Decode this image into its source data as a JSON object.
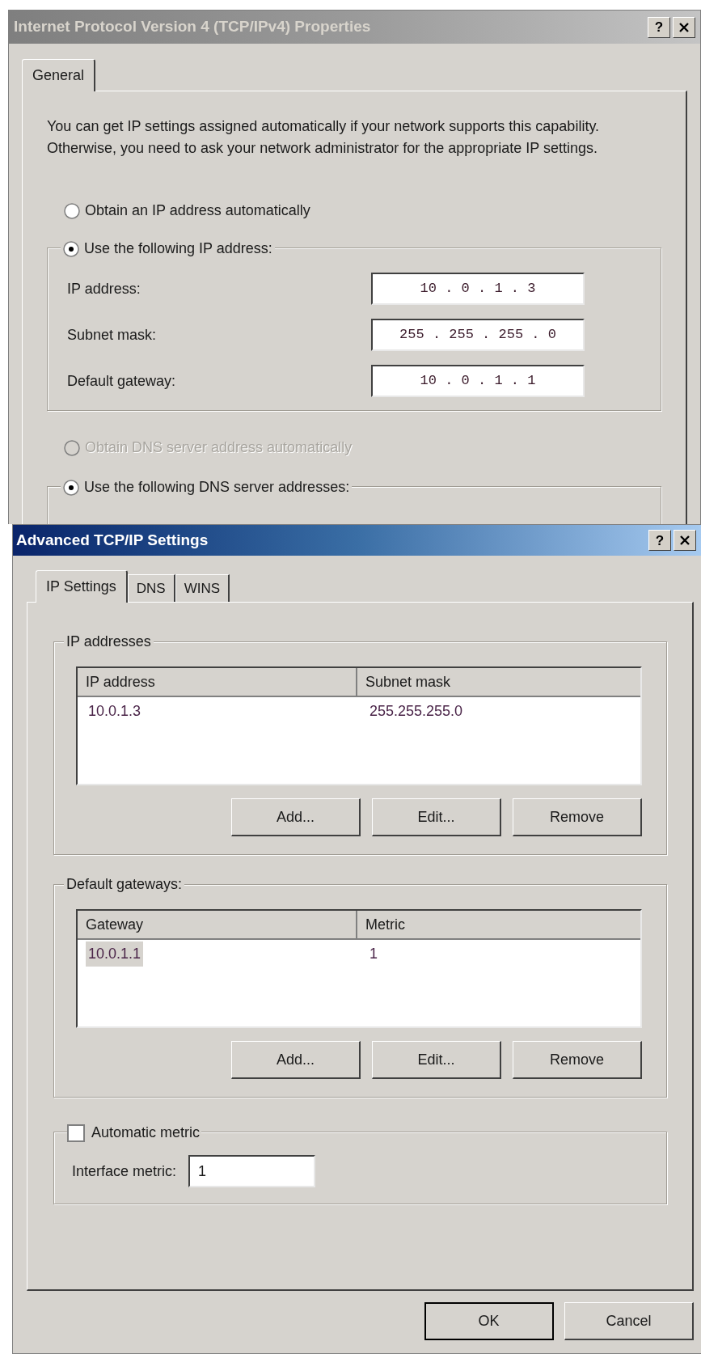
{
  "back_dialog": {
    "title": "Internet Protocol Version 4 (TCP/IPv4) Properties",
    "active": false,
    "help_button": "?",
    "tabs": [
      {
        "label": "General",
        "selected": true
      }
    ],
    "description": "You can get IP settings assigned automatically if your network supports this capability. Otherwise, you need to ask your network administrator for the appropriate IP settings.",
    "ip_options": [
      {
        "label": "Obtain an IP address automatically",
        "selected": false,
        "disabled": false
      },
      {
        "label": "Use the following IP address:",
        "selected": true,
        "disabled": false
      }
    ],
    "ip_fields": [
      {
        "label": "IP address:",
        "value": "10 . 0 . 1 . 3"
      },
      {
        "label": "Subnet mask:",
        "value": "255 . 255 . 255 . 0"
      },
      {
        "label": "Default gateway:",
        "value": "10 . 0 . 1 . 1"
      }
    ],
    "dns_options": [
      {
        "label": "Obtain DNS server address automatically",
        "selected": false,
        "disabled": true
      },
      {
        "label": "Use the following DNS server addresses:",
        "selected": true,
        "disabled": false
      }
    ]
  },
  "front_dialog": {
    "title": "Advanced TCP/IP Settings",
    "active": true,
    "help_button": "?",
    "tabs": [
      {
        "label": "IP Settings",
        "selected": true
      },
      {
        "label": "DNS",
        "selected": false
      },
      {
        "label": "WINS",
        "selected": false
      }
    ],
    "groups": [
      {
        "title": "IP addresses",
        "columns": [
          "IP address",
          "Subnet mask"
        ],
        "rows": [
          {
            "cells": [
              "10.0.1.3",
              "255.255.255.0"
            ],
            "selected": false
          }
        ],
        "buttons": [
          "Add...",
          "Edit...",
          "Remove"
        ]
      },
      {
        "title": "Default gateways:",
        "columns": [
          "Gateway",
          "Metric"
        ],
        "rows": [
          {
            "cells": [
              "10.0.1.1",
              "1"
            ],
            "selected": true
          }
        ],
        "buttons": [
          "Add...",
          "Edit...",
          "Remove"
        ]
      }
    ],
    "automatic_metric": {
      "label": "Automatic metric",
      "checked": false
    },
    "interface_metric": {
      "label": "Interface metric:",
      "value": "1"
    },
    "buttons": [
      {
        "label": "OK",
        "default": true
      },
      {
        "label": "Cancel",
        "default": false
      }
    ]
  }
}
